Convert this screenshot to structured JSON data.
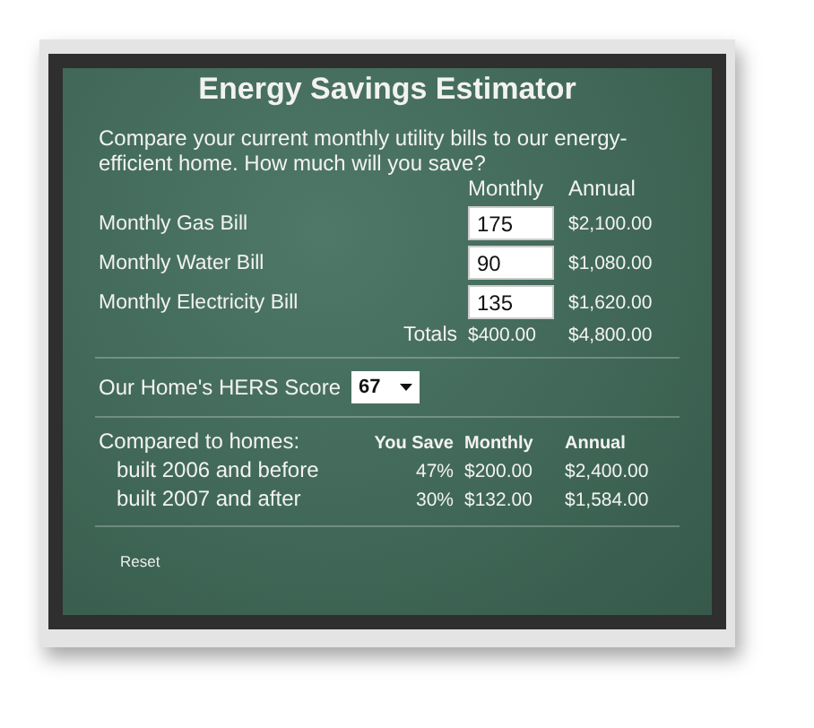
{
  "title": "Energy Savings Estimator",
  "intro": "Compare your current monthly utility bills to our energy-efficient home. How much will you save?",
  "bills": {
    "columns": [
      "Monthly",
      "Annual"
    ],
    "rows": [
      {
        "label": "Monthly Gas Bill",
        "value": "175",
        "annual": "$2,100.00"
      },
      {
        "label": "Monthly Water Bill",
        "value": "90",
        "annual": "$1,080.00"
      },
      {
        "label": "Monthly Electricity Bill",
        "value": "135",
        "annual": "$1,620.00"
      }
    ],
    "totals": {
      "label": "Totals",
      "monthly": "$400.00",
      "annual": "$4,800.00"
    }
  },
  "hers": {
    "label": "Our Home's HERS Score",
    "value": "67"
  },
  "comparison": {
    "label": "Compared to homes:",
    "columns": [
      "You Save",
      "Monthly",
      "Annual"
    ],
    "rows": [
      {
        "label": "built 2006 and before",
        "save": "47%",
        "monthly": "$200.00",
        "annual": "$2,400.00"
      },
      {
        "label": "built 2007 and after",
        "save": "30%",
        "monthly": "$132.00",
        "annual": "$1,584.00"
      }
    ]
  },
  "reset": "Reset"
}
